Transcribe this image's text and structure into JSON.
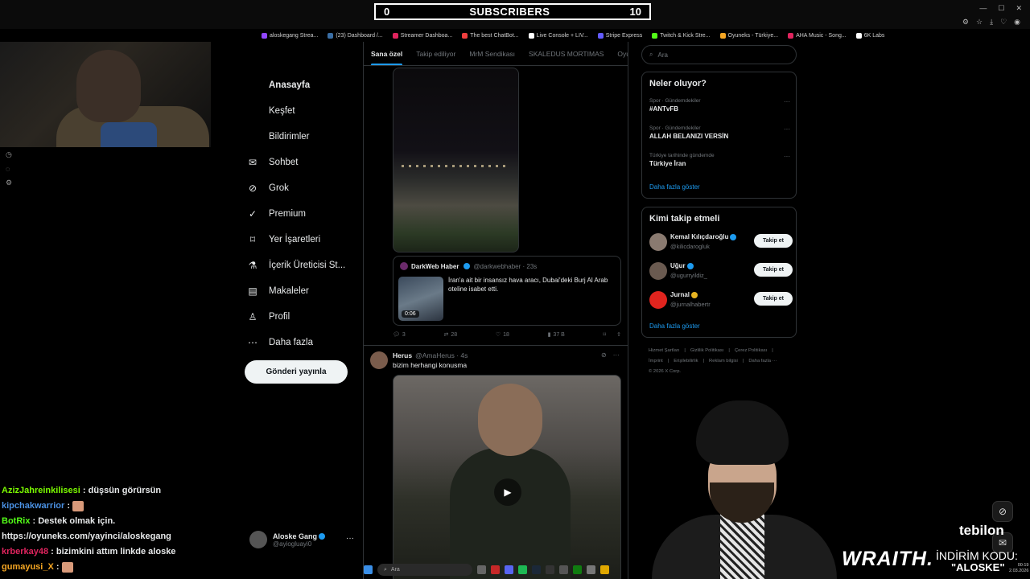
{
  "subscribers": {
    "left": "0",
    "label": "SUBSCRIBERS",
    "right": "10"
  },
  "bookmarks": [
    {
      "label": "aloskegang Strea...",
      "color": "#9146ff"
    },
    {
      "label": "(23) Dashboard /...",
      "color": "#3a6ea5"
    },
    {
      "label": "Streamer Dashboa...",
      "color": "#e0245e"
    },
    {
      "label": "The best ChatBot...",
      "color": "#f03e3e"
    },
    {
      "label": "Live Console + LIV...",
      "color": "#ffffff"
    },
    {
      "label": "Stripe Express",
      "color": "#635bff"
    },
    {
      "label": "Twitch & Kick Stre...",
      "color": "#53fc18"
    },
    {
      "label": "Oyuneks - Türkiye...",
      "color": "#f5a623"
    },
    {
      "label": "AHA Music - Song...",
      "color": "#e0245e"
    },
    {
      "label": "6K Labs",
      "color": "#ffffff"
    }
  ],
  "nav": {
    "items": [
      {
        "label": "Anasayfa",
        "icon": "home-icon"
      },
      {
        "label": "Keşfet",
        "icon": "search-icon"
      },
      {
        "label": "Bildirimler",
        "icon": "bell-icon"
      },
      {
        "label": "Sohbet",
        "icon": "mail-icon"
      },
      {
        "label": "Grok",
        "icon": "grok-icon"
      },
      {
        "label": "Premium",
        "icon": "premium-icon"
      },
      {
        "label": "Yer İşaretleri",
        "icon": "bookmark-icon"
      },
      {
        "label": "İçerik Üreticisi St...",
        "icon": "creator-icon"
      },
      {
        "label": "Makaleler",
        "icon": "article-icon"
      },
      {
        "label": "Profil",
        "icon": "profile-icon"
      },
      {
        "label": "Daha fazla",
        "icon": "more-icon"
      }
    ],
    "post_button": "Gönderi yayınla"
  },
  "profile": {
    "name": "Aloske Gang",
    "handle": "@ayiogluayi0",
    "more": "···"
  },
  "tabs": [
    "Sana özel",
    "Takip ediliyor",
    "MrM Sendikası",
    "SKALEDUS MORTIMAS",
    "Oyu"
  ],
  "quote": {
    "name": "DarkWeb Haber",
    "meta": "@darkwebhaber · 23s",
    "duration": "0:06",
    "text": "İran'a ait bir insansız hava aracı, Dubai'deki Burj Al Arab oteline isabet etti."
  },
  "actions": {
    "replies": "3",
    "reposts": "28",
    "likes": "18",
    "views": "37 B"
  },
  "post2": {
    "name": "Herus",
    "meta": "@AmaHerus · 4s",
    "text": "bizim herhangi konusma"
  },
  "search": {
    "placeholder": "Ara"
  },
  "trends": {
    "title": "Neler oluyor?",
    "items": [
      {
        "category": "Spor · Gündemdekiler",
        "name": "#ANTvFB"
      },
      {
        "category": "Spor · Gündemdekiler",
        "name": "ALLAH BELANIZI VERSİN"
      },
      {
        "category": "Türkiye tarihinde gündemde",
        "name": "Türkiye İran"
      }
    ],
    "show_more": "Daha fazla göster"
  },
  "who_to_follow": {
    "title": "Kimi takip etmeli",
    "users": [
      {
        "name": "Kemal Kılıçdaroğlu",
        "handle": "@kilicdarogluk",
        "button": "Takip et",
        "badge": "blue",
        "color": "#8a7a70"
      },
      {
        "name": "Uğur",
        "handle": "@ugurryildiz_",
        "button": "Takip et",
        "badge": "blue",
        "color": "#6a5a50"
      },
      {
        "name": "Jurnal",
        "handle": "@jurnalhabertr",
        "button": "Takip et",
        "badge": "gold",
        "color": "#e0241e"
      }
    ],
    "show_more": "Daha fazla göster"
  },
  "footer": {
    "links": [
      "Hizmet Şartları",
      "Gizlilik Politikası",
      "Çerez Politikası",
      "İmprint",
      "Erişilebilirlik",
      "Reklam bilgisi",
      "Daha fazla ···"
    ],
    "copyright": "© 2026 X Corp."
  },
  "chat": [
    {
      "user": "AzizJahreinkilisesi",
      "color": "#7cfc00",
      "message": " : düşsün görürsün",
      "emote": false
    },
    {
      "user": "kipchakwarrior",
      "color": "#4a90e2",
      "message": " : ",
      "emote": true
    },
    {
      "user": "BotRix",
      "color": "#53fc18",
      "message": " : Destek olmak için.",
      "emote": false
    },
    {
      "user": "",
      "color": "#ffffff",
      "message": "https://oyuneks.com/yayinci/aloskegang",
      "emote": false
    },
    {
      "user": "krberkay48",
      "color": "#e0245e",
      "message": " : bizimkini attım linkde aloske",
      "emote": false
    },
    {
      "user": "gumayusi_X",
      "color": "#f5a623",
      "message": " : ",
      "emote": true
    }
  ],
  "taskbar": {
    "search_placeholder": "Ara"
  },
  "clock": {
    "time": "00:19",
    "date": "2.03.2026"
  },
  "overlay": {
    "brand": "WRAITH.",
    "promo_line1": "İNDİRİM KODU:",
    "promo_line2": "\"ALOSKE\"",
    "sponsor": "tebilon"
  }
}
